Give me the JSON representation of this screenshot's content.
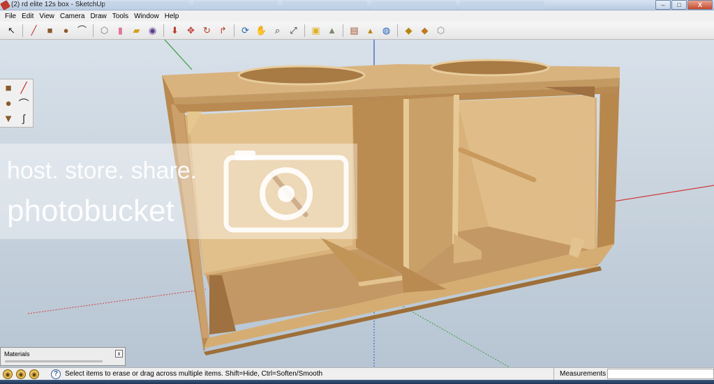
{
  "window": {
    "title": "(2) rd elite 12s box - SketchUp",
    "buttons": {
      "minimize": "–",
      "maximize": "□",
      "close": "X"
    }
  },
  "menubar": [
    {
      "id": "file",
      "label": "File"
    },
    {
      "id": "edit",
      "label": "Edit"
    },
    {
      "id": "view",
      "label": "View"
    },
    {
      "id": "camera",
      "label": "Camera"
    },
    {
      "id": "draw",
      "label": "Draw"
    },
    {
      "id": "tools",
      "label": "Tools"
    },
    {
      "id": "window",
      "label": "Window"
    },
    {
      "id": "help",
      "label": "Help"
    }
  ],
  "toolbar": [
    {
      "name": "select-tool",
      "glyph": "↖",
      "color": "#222222"
    },
    {
      "sep": true
    },
    {
      "name": "line-tool",
      "glyph": "╱",
      "color": "#c62828"
    },
    {
      "name": "rectangle-tool",
      "glyph": "■",
      "color": "#8b5a2b"
    },
    {
      "name": "circle-tool",
      "glyph": "●",
      "color": "#8b5a2b"
    },
    {
      "name": "arc-tool",
      "glyph": "⌒",
      "color": "#333333"
    },
    {
      "sep": true
    },
    {
      "name": "make-component-tool",
      "glyph": "⬡",
      "color": "#777777"
    },
    {
      "name": "eraser-tool",
      "glyph": "▮",
      "color": "#e57399"
    },
    {
      "name": "tape-measure-tool",
      "glyph": "▰",
      "color": "#d4a017"
    },
    {
      "name": "paint-bucket-tool",
      "glyph": "◉",
      "color": "#5a3a8c"
    },
    {
      "sep": true
    },
    {
      "name": "push-pull-tool",
      "glyph": "⬇",
      "color": "#c0392b"
    },
    {
      "name": "move-tool",
      "glyph": "✥",
      "color": "#c0392b"
    },
    {
      "name": "rotate-tool",
      "glyph": "↻",
      "color": "#c0392b"
    },
    {
      "name": "follow-me-tool",
      "glyph": "↱",
      "color": "#c0392b"
    },
    {
      "sep": true
    },
    {
      "name": "orbit-tool",
      "glyph": "⟳",
      "color": "#1f5fbf"
    },
    {
      "name": "pan-tool",
      "glyph": "✋",
      "color": "#555555"
    },
    {
      "name": "zoom-tool",
      "glyph": "⌕",
      "color": "#333333"
    },
    {
      "name": "zoom-extents-tool",
      "glyph": "⤢",
      "color": "#333333"
    },
    {
      "sep": true
    },
    {
      "name": "add-location-tool",
      "glyph": "▣",
      "color": "#e0b020"
    },
    {
      "name": "toggle-terrain-tool",
      "glyph": "▲",
      "color": "#7a8a70"
    },
    {
      "sep": true
    },
    {
      "name": "get-models-tool",
      "glyph": "▤",
      "color": "#a0522d"
    },
    {
      "name": "share-model-tool",
      "glyph": "▴",
      "color": "#b8860b"
    },
    {
      "name": "google-earth-tool",
      "glyph": "◍",
      "color": "#1f5fbf"
    },
    {
      "sep": true
    },
    {
      "name": "get-components-tool",
      "glyph": "◆",
      "color": "#b8860b"
    },
    {
      "name": "share-component-tool",
      "glyph": "◆",
      "color": "#c07a1a"
    },
    {
      "name": "extension-warehouse-tool",
      "glyph": "⬡",
      "color": "#888888"
    }
  ],
  "palette": [
    {
      "name": "rectangle-tool",
      "glyph": "■",
      "color": "#8b5a2b"
    },
    {
      "name": "line-tool",
      "glyph": "╱",
      "color": "#c62828"
    },
    {
      "name": "circle-tool",
      "glyph": "●",
      "color": "#8b5a2b"
    },
    {
      "name": "arc-tool",
      "glyph": "⌒",
      "color": "#333333"
    },
    {
      "name": "polygon-tool",
      "glyph": "▼",
      "color": "#8b5a2b"
    },
    {
      "name": "freehand-tool",
      "glyph": "ʃ",
      "color": "#333333"
    }
  ],
  "watermark": {
    "line1": "host. store. share.",
    "line2": "photobucket"
  },
  "materials_panel": {
    "title": "Materials",
    "close": "x"
  },
  "statusbar": {
    "icons": [
      "geo-location-icon",
      "credits-icon",
      "user-icon"
    ],
    "message": "Select items to erase or drag across multiple items. Shift=Hide, Ctrl=Soften/Smooth",
    "measurements_label": "Measurements",
    "measurements_value": ""
  },
  "colors": {
    "wood_light": "#e1c08c",
    "wood_mid": "#cfa56b",
    "wood_dark": "#a8773f",
    "wood_shadow": "#8e6333",
    "axis_red": "#d33a3a",
    "axis_green": "#3c9a3c",
    "axis_blue": "#3355c8"
  }
}
